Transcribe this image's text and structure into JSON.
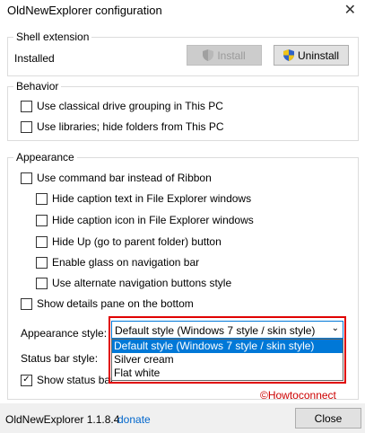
{
  "window": {
    "title": "OldNewExplorer configuration",
    "close_glyph": "✕"
  },
  "shell": {
    "legend": "Shell extension",
    "status": "Installed",
    "install_label": "Install",
    "uninstall_label": "Uninstall"
  },
  "behavior": {
    "legend": "Behavior",
    "items": [
      {
        "label": "Use classical drive grouping in This PC",
        "checked": false
      },
      {
        "label": "Use libraries; hide folders from This PC",
        "checked": false
      }
    ]
  },
  "appearance": {
    "legend": "Appearance",
    "command_bar": {
      "label": "Use command bar instead of Ribbon",
      "checked": false
    },
    "sub_items": [
      {
        "label": "Hide caption text in File Explorer windows",
        "checked": false
      },
      {
        "label": "Hide caption icon in File Explorer windows",
        "checked": false
      },
      {
        "label": "Hide Up (go to parent folder) button",
        "checked": false
      },
      {
        "label": "Enable glass on navigation bar",
        "checked": false
      },
      {
        "label": "Use alternate navigation buttons style",
        "checked": false
      }
    ],
    "details_pane": {
      "label": "Show details pane on the bottom",
      "checked": false
    },
    "style_label": "Appearance style:",
    "style_value": "Default style (Windows 7 style / skin style)",
    "style_options": [
      "Default style (Windows 7 style / skin style)",
      "Silver cream",
      "Flat white"
    ],
    "status_bar_style_label": "Status bar style:",
    "show_status_bar": {
      "label": "Show status bar",
      "checked": true
    }
  },
  "footer": {
    "version": "OldNewExplorer 1.1.8.4",
    "donate": "donate",
    "close_label": "Close"
  },
  "watermark": "©Howtoconnect",
  "colors": {
    "accent": "#0078d7",
    "highlight_border": "#e00000",
    "link": "#0066cc"
  }
}
